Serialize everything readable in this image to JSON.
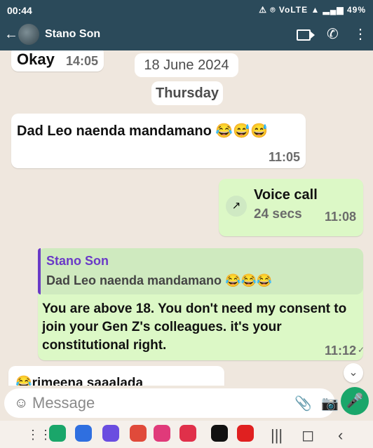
{
  "status_bar": {
    "time": "00:44",
    "battery": "49%",
    "indicators": "⚠ ⌾ VoLTE ▲ ▂▄▆ 49%"
  },
  "header": {
    "contact_name": "Stano Son"
  },
  "chat": {
    "prev_message": {
      "text": "Okay",
      "time": "14:05"
    },
    "date_label": "18 June 2024",
    "day_label": "Thursday",
    "incoming": {
      "text": "Dad Leo naenda mandamano 😂😅😅",
      "time": "11:05"
    },
    "voice_call": {
      "title": "Voice call",
      "duration": "24 secs",
      "time": "11:08"
    },
    "reply": {
      "quoted_name": "Stano Son",
      "quoted_text": "Dad Leo naenda mandamano 😂😂😂",
      "text": "You are above 18. You don't need my consent to join your Gen Z's colleagues. it's your constitutional right.",
      "time": "11:12"
    },
    "partial_message": "😂rimeena saaalada"
  },
  "composer": {
    "placeholder": "Message"
  },
  "nav_apps": [
    {
      "name": "contacts",
      "color": "#1aa66a",
      "glyph": "C"
    },
    {
      "name": "messages",
      "color": "#2f6fe0",
      "glyph": "💬"
    },
    {
      "name": "internet",
      "color": "#6a4de0",
      "glyph": "◯"
    },
    {
      "name": "notes",
      "color": "#e04a3a",
      "glyph": "▤"
    },
    {
      "name": "flower-app",
      "color": "#e03a7a",
      "glyph": "✿"
    },
    {
      "name": "camera-app",
      "color": "#e0304a",
      "glyph": "◉"
    },
    {
      "name": "x-app",
      "color": "#111111",
      "glyph": "X"
    },
    {
      "name": "youtube",
      "color": "#e02020",
      "glyph": "▶"
    }
  ]
}
